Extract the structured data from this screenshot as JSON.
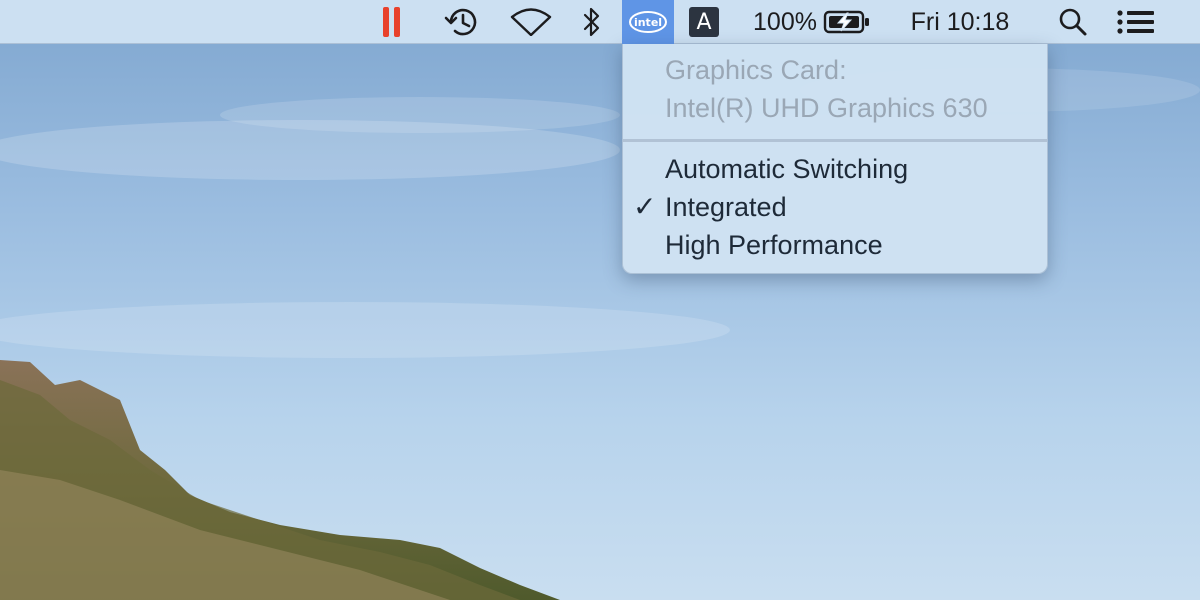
{
  "menubar": {
    "clock": "Fri 10:18",
    "battery_percent": "100%",
    "input_source_letter": "A",
    "intel_logo_text": "intel",
    "icons": [
      "pause-icon",
      "time-machine-icon",
      "wifi-icon",
      "bluetooth-icon",
      "intel-gpu-icon",
      "input-source-icon",
      "battery-charging-icon",
      "spotlight-search-icon",
      "notification-center-icon"
    ]
  },
  "gpu_menu": {
    "header_label": "Graphics Card:",
    "current_card": "Intel(R) UHD Graphics 630",
    "items": [
      {
        "label": "Automatic Switching",
        "checked": false
      },
      {
        "label": "Integrated",
        "checked": true
      },
      {
        "label": "High Performance",
        "checked": false
      }
    ],
    "check_mark": "✓"
  },
  "colors": {
    "pause_red": "#e8412c",
    "intel_highlight": "#5f95e6",
    "menu_text": "#1e2a38",
    "menu_disabled_text": "#9aa7b5"
  }
}
